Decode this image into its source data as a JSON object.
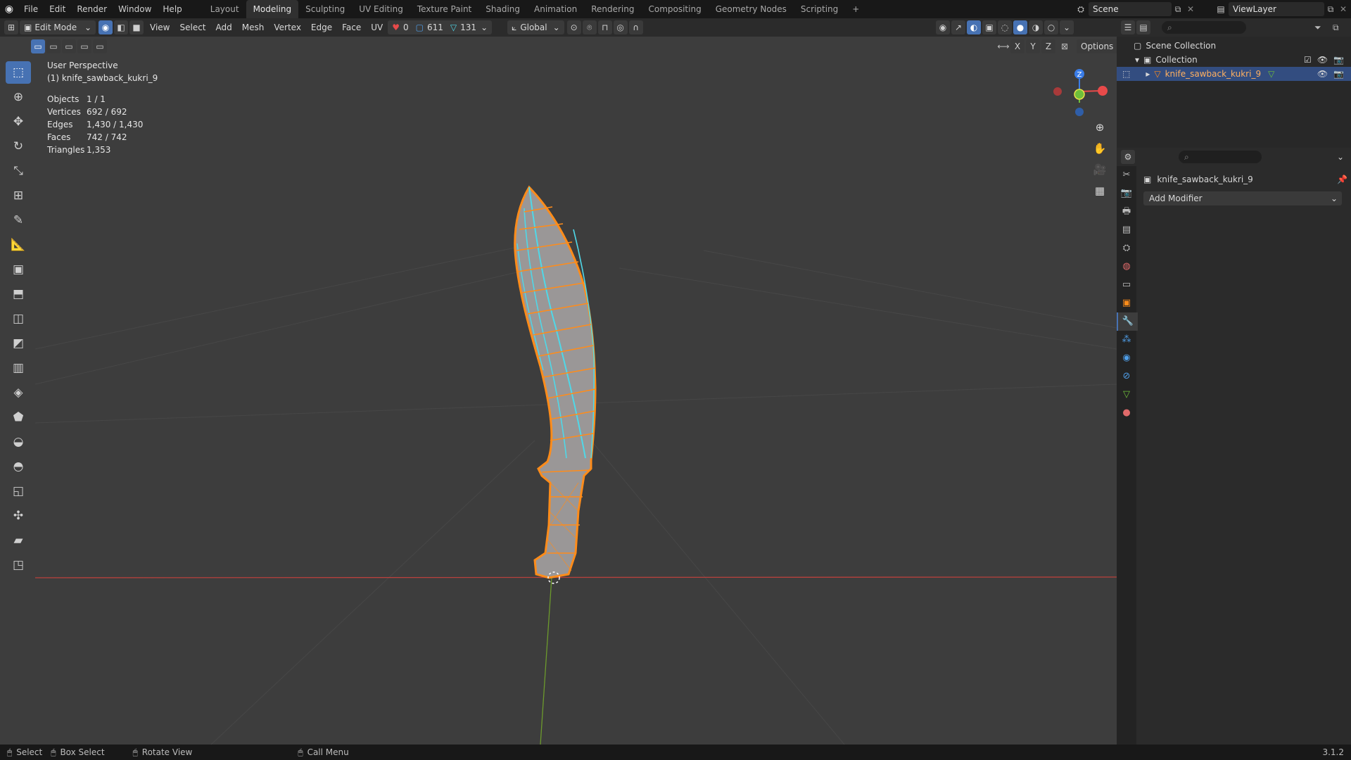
{
  "menu": [
    "File",
    "Edit",
    "Render",
    "Window",
    "Help"
  ],
  "workspace_tabs": [
    "Layout",
    "Modeling",
    "Sculpting",
    "UV Editing",
    "Texture Paint",
    "Shading",
    "Animation",
    "Rendering",
    "Compositing",
    "Geometry Nodes",
    "Scripting"
  ],
  "active_workspace": "Modeling",
  "scene_name": "Scene",
  "view_layer": "ViewLayer",
  "viewport_header": {
    "mode": "Edit Mode",
    "menus": [
      "View",
      "Select",
      "Add",
      "Mesh",
      "Vertex",
      "Edge",
      "Face",
      "UV"
    ],
    "counter_red": "0",
    "counter_edges": "611",
    "counter_faces": "131",
    "transform_orientation": "Global",
    "options": "Options",
    "axes": [
      "X",
      "Y",
      "Z"
    ]
  },
  "overlay": {
    "view_name": "User Perspective",
    "object_name": "(1) knife_sawback_kukri_9",
    "stats": [
      {
        "label": "Objects",
        "value": "1 / 1"
      },
      {
        "label": "Vertices",
        "value": "692 / 692"
      },
      {
        "label": "Edges",
        "value": "1,430 / 1,430"
      },
      {
        "label": "Faces",
        "value": "742 / 742"
      },
      {
        "label": "Triangles",
        "value": "1,353"
      }
    ]
  },
  "gizmo": {
    "z": "Z"
  },
  "outliner": {
    "scene_collection": "Scene Collection",
    "collection": "Collection",
    "object": "knife_sawback_kukri_9"
  },
  "properties": {
    "object": "knife_sawback_kukri_9",
    "add_modifier": "Add Modifier"
  },
  "statusbar": {
    "select": "Select",
    "box_select": "Box Select",
    "rotate_view": "Rotate View",
    "call_menu": "Call Menu",
    "version": "3.1.2"
  },
  "colors": {
    "accent": "#4772b3",
    "selection_orange": "#ff8c1a",
    "edge_cyan": "#4fd8e8",
    "x_axis": "#e84a4a",
    "y_axis": "#6fbf3a",
    "z_axis": "#3a7de8"
  }
}
